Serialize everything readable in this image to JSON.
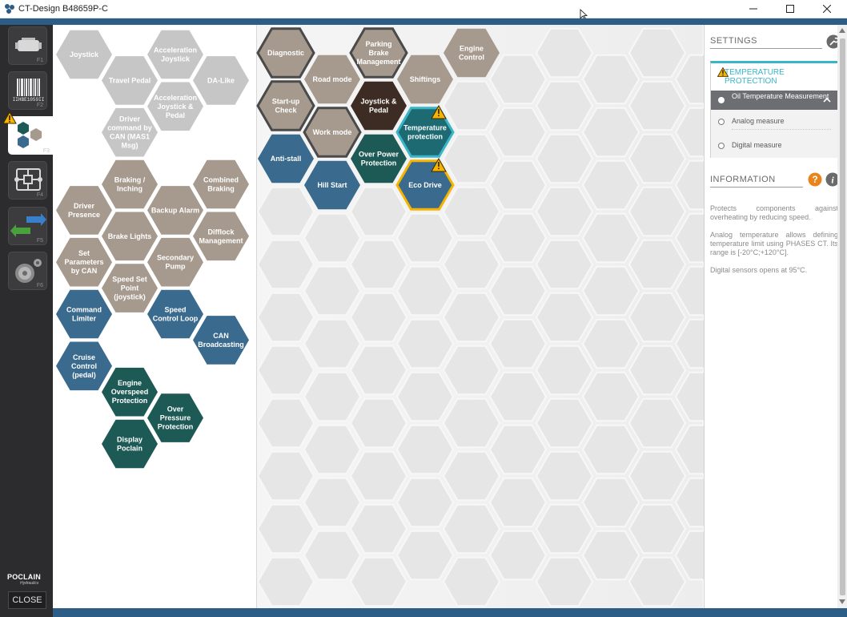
{
  "window": {
    "title": "CT-Design B48659P-C",
    "controls": [
      "minimize",
      "maximize",
      "close"
    ]
  },
  "rail": {
    "items": [
      {
        "icon": "engine-icon",
        "key": "F1"
      },
      {
        "icon": "barcode-icon",
        "key": "F2",
        "code": "IIHBE1059II"
      },
      {
        "icon": "hexagon-functions-icon",
        "key": "F3",
        "active": true,
        "warning": true
      },
      {
        "icon": "hydraulic-diagram-icon",
        "key": "F4"
      },
      {
        "icon": "transfer-arrows-icon",
        "key": "F5"
      },
      {
        "icon": "settings-gears-icon",
        "key": "F6"
      }
    ],
    "logo": {
      "brand": "POCLAIN",
      "sub": "Hydraulics"
    },
    "close_label": "CLOSE"
  },
  "palette": {
    "functions": [
      {
        "label": "Joystick",
        "style": "light"
      },
      {
        "label": "Acceleration Joystick",
        "style": "light"
      },
      {
        "label": "Travel Pedal",
        "style": "light"
      },
      {
        "label": "DA-Like",
        "style": "light"
      },
      {
        "label": "Acceleration Joystick & Pedal",
        "style": "light"
      },
      {
        "label": "Driver command by CAN (MAS1 Msg)",
        "style": "light"
      },
      {
        "label": "Braking / Inching",
        "style": "taupe"
      },
      {
        "label": "Combined Braking",
        "style": "taupe"
      },
      {
        "label": "Driver Presence",
        "style": "taupe"
      },
      {
        "label": "Backup Alarm",
        "style": "taupe"
      },
      {
        "label": "Brake Lights",
        "style": "taupe"
      },
      {
        "label": "Difflock Management",
        "style": "taupe"
      },
      {
        "label": "Set Parameters by CAN",
        "style": "taupe"
      },
      {
        "label": "Secondary Pump",
        "style": "taupe"
      },
      {
        "label": "Speed Set Point (joystick)",
        "style": "taupe"
      },
      {
        "label": "Command Limiter",
        "style": "blue"
      },
      {
        "label": "Speed Control Loop",
        "style": "blue"
      },
      {
        "label": "CAN Broadcasting",
        "style": "blue"
      },
      {
        "label": "Cruise Control (pedal)",
        "style": "blue"
      },
      {
        "label": "Engine Overspeed Protection",
        "style": "green"
      },
      {
        "label": "Over Pressure Protection",
        "style": "green"
      },
      {
        "label": "Display Poclain",
        "style": "green"
      }
    ]
  },
  "grid": {
    "placed": [
      {
        "label": "Diagnostic",
        "style": "taupe-outlined"
      },
      {
        "label": "Parking Brake Management",
        "style": "taupe-outlined"
      },
      {
        "label": "Engine Control",
        "style": "taupe"
      },
      {
        "label": "Road mode",
        "style": "taupe"
      },
      {
        "label": "Shiftings",
        "style": "taupe"
      },
      {
        "label": "Start-up Check",
        "style": "taupe-outlined"
      },
      {
        "label": "Joystick & Pedal",
        "style": "dark"
      },
      {
        "label": "Temperature protection",
        "style": "selected",
        "warning": true
      },
      {
        "label": "Work mode",
        "style": "taupe-outlined"
      },
      {
        "label": "Anti-stall",
        "style": "blue"
      },
      {
        "label": "Over Power Protection",
        "style": "green"
      },
      {
        "label": "Eco Drive",
        "style": "warning",
        "warning": true
      },
      {
        "label": "Hill Start",
        "style": "blue"
      }
    ]
  },
  "colors": {
    "light": "#c6c6c6",
    "taupe": "#a69a8e",
    "blue": "#3a6a8e",
    "green": "#1d5a55",
    "dark": "#3d2c23",
    "selected": "#1d6a73",
    "highlight": "#3ab5c8",
    "warning": "#f5b400",
    "empty": "#e6e6e6"
  },
  "settings": {
    "header": "SETTINGS",
    "group_title": "TEMPERATURE PROTECTION",
    "selected_option": "Oil Temperature Measurement",
    "options": [
      "Analog measure",
      "Digital measure"
    ]
  },
  "information": {
    "header": "INFORMATION",
    "paragraphs": [
      "Protects components against overheating by reducing speed.",
      "Analog temperature allows defining temperature limit using PHASES CT. Its range is [-20°C;+120°C].",
      "Digital sensors opens at 95°C."
    ]
  }
}
